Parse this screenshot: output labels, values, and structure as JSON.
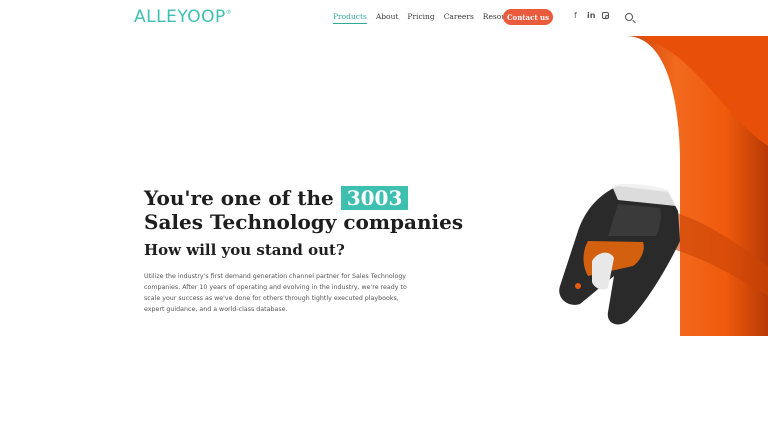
{
  "brand": {
    "logo": "ALLEYOOP",
    "mark": "®"
  },
  "nav": {
    "items": [
      {
        "label": "Products",
        "active": true
      },
      {
        "label": "About"
      },
      {
        "label": "Pricing"
      },
      {
        "label": "Careers"
      },
      {
        "label": "Resources"
      }
    ],
    "contact_label": "Contact us"
  },
  "social": {
    "facebook": "f",
    "linkedin": "in"
  },
  "hero": {
    "title_prefix": "You're one of the",
    "highlight_number": "3003",
    "title_line2": "Sales Technology companies",
    "subheading": "How will you stand out?",
    "body": "Utilize the industry's first demand generation channel partner for Sales Technology companies. After 10 years of operating and evolving in the industry, we're ready to scale your success as we've done for others through tightly executed playbooks, expert guidance, and a world-class database."
  },
  "colors": {
    "accent": "#3ec0b0",
    "cta": "#ea5a3c",
    "product": "#f05a0c"
  },
  "icons": [
    "facebook-icon",
    "linkedin-icon",
    "instagram-icon",
    "search-icon"
  ]
}
